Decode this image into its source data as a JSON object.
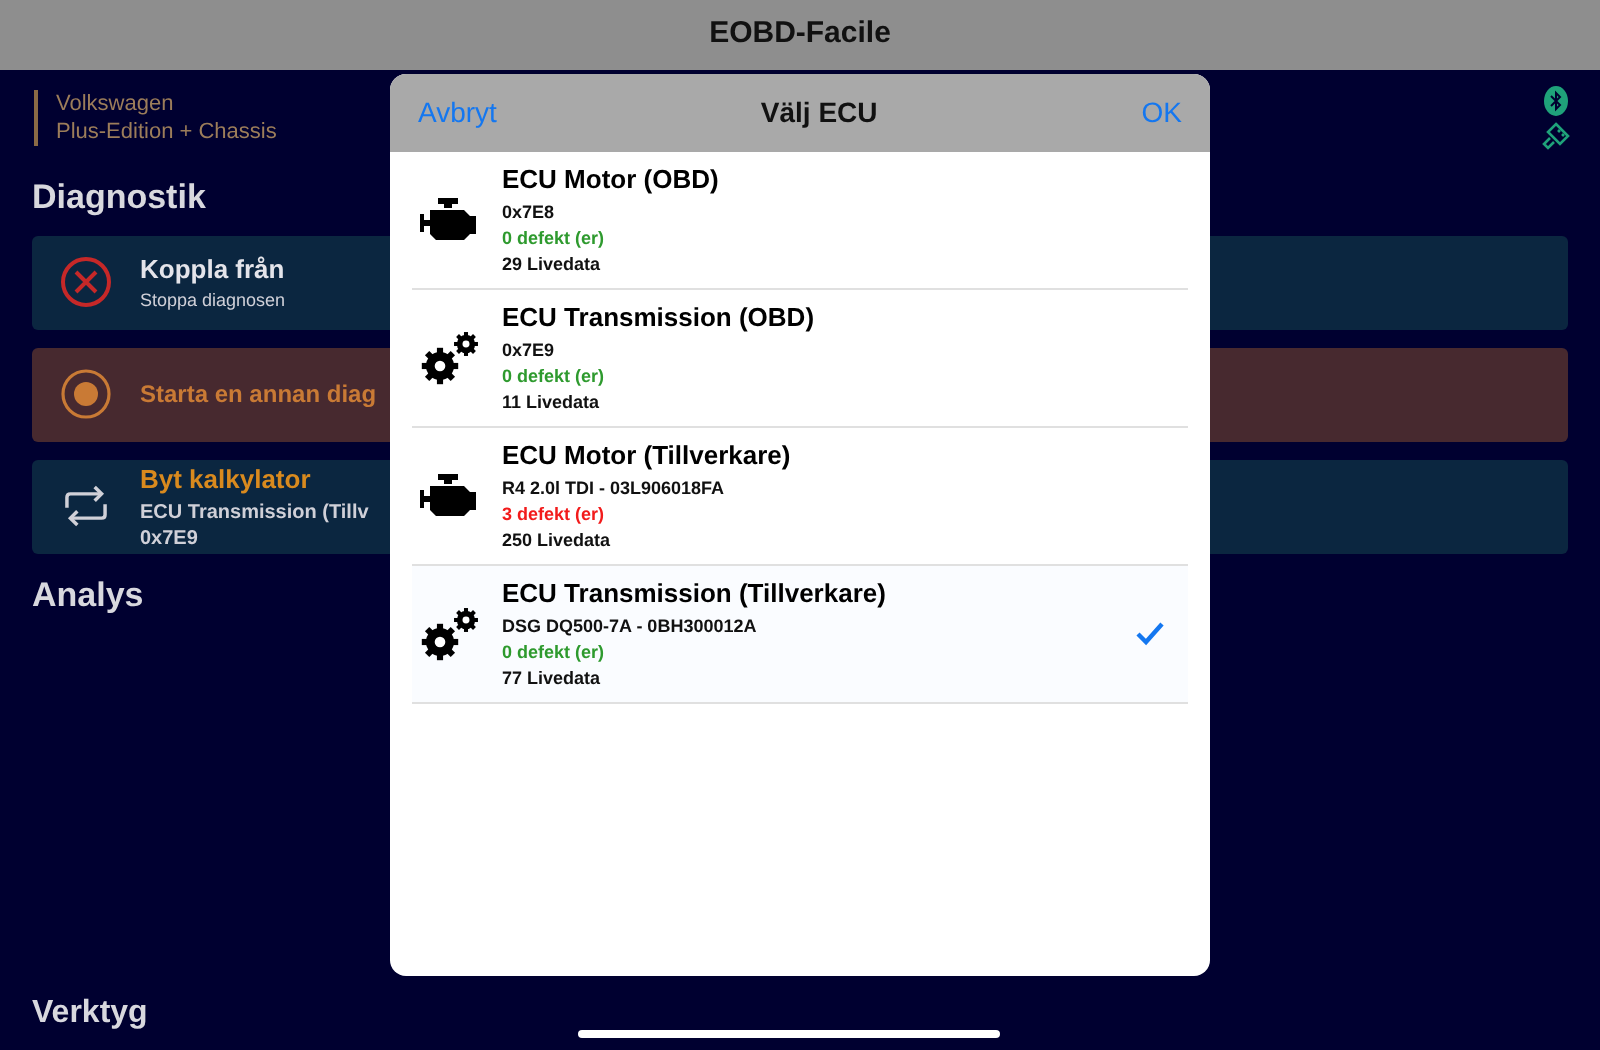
{
  "app_title": "EOBD-Facile",
  "vehicle": {
    "make": "Volkswagen",
    "edition": "Plus-Edition + Chassis"
  },
  "sections": [
    "Diagnostik",
    "Analys",
    "Verktyg"
  ],
  "actions": [
    {
      "kind": "disconnect",
      "title": "Koppla från",
      "subtitle": "Stoppa diagnosen"
    },
    {
      "kind": "start",
      "title": "Starta en annan diag"
    },
    {
      "kind": "switch",
      "title": "Byt kalkylator",
      "subtitle": "ECU Transmission (Tillv",
      "detail": "0x7E9"
    }
  ],
  "dialog": {
    "title": "Välj ECU",
    "cancel": "Avbryt",
    "ok": "OK",
    "items": [
      {
        "kind": "engine",
        "name": "ECU Motor (OBD)",
        "id": "0x7E8",
        "faults": "0 defekt (er)",
        "faulty": false,
        "livedata": "29 Livedata",
        "selected": false
      },
      {
        "kind": "gearbox",
        "name": "ECU Transmission (OBD)",
        "id": "0x7E9",
        "faults": "0 defekt (er)",
        "faulty": false,
        "livedata": "11 Livedata",
        "selected": false
      },
      {
        "kind": "engine",
        "name": "ECU Motor (Tillverkare)",
        "id": "R4 2.0l TDI - 03L906018FA",
        "faults": "3 defekt (er)",
        "faulty": true,
        "livedata": "250 Livedata",
        "selected": false
      },
      {
        "kind": "gearbox",
        "name": "ECU Transmission (Tillverkare)",
        "id": "DSG DQ500-7A - 0BH300012A",
        "faults": "0 defekt (er)",
        "faulty": false,
        "livedata": "77 Livedata",
        "selected": true
      }
    ]
  }
}
